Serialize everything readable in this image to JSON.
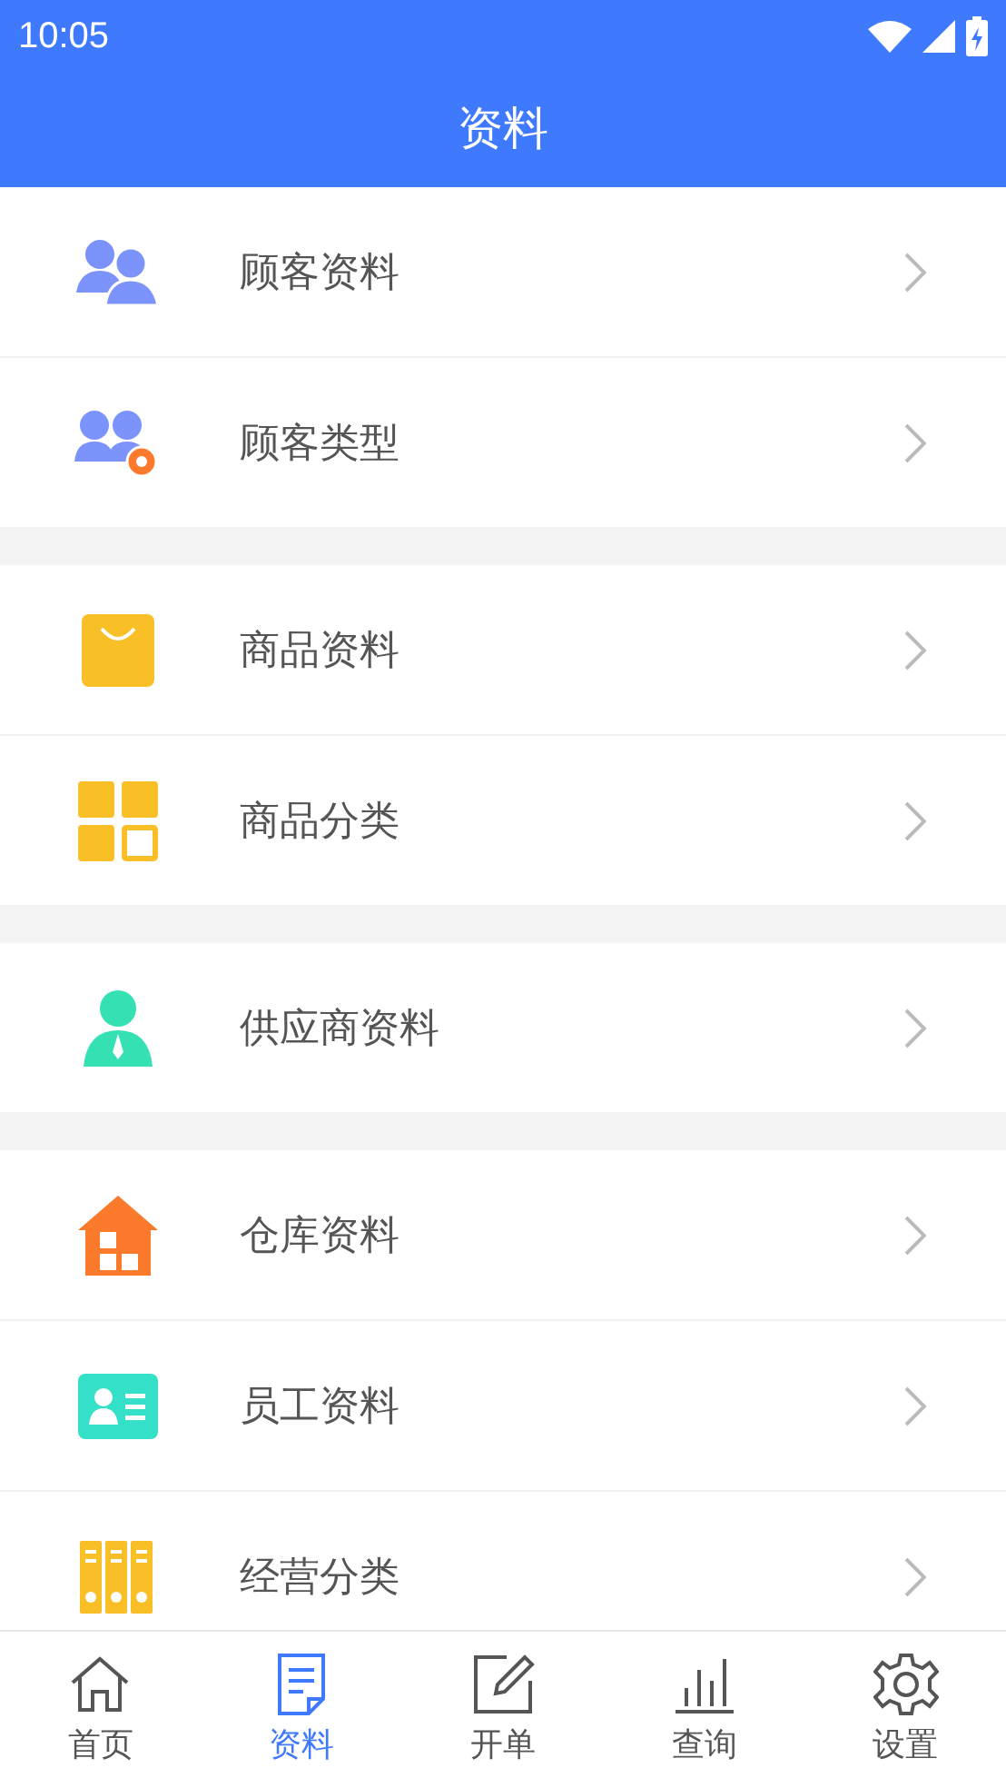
{
  "status_bar": {
    "time": "10:05"
  },
  "header": {
    "title": "资料"
  },
  "groups": [
    {
      "items": [
        {
          "label": "顾客资料"
        },
        {
          "label": "顾客类型"
        }
      ]
    },
    {
      "items": [
        {
          "label": "商品资料"
        },
        {
          "label": "商品分类"
        }
      ]
    },
    {
      "items": [
        {
          "label": "供应商资料"
        }
      ]
    },
    {
      "items": [
        {
          "label": "仓库资料"
        },
        {
          "label": "员工资料"
        },
        {
          "label": "经营分类"
        }
      ]
    }
  ],
  "tab_bar": [
    {
      "label": "首页",
      "selected": false
    },
    {
      "label": "资料",
      "selected": true
    },
    {
      "label": "开单",
      "selected": false
    },
    {
      "label": "查询",
      "selected": false
    },
    {
      "label": "设置",
      "selected": false
    }
  ]
}
